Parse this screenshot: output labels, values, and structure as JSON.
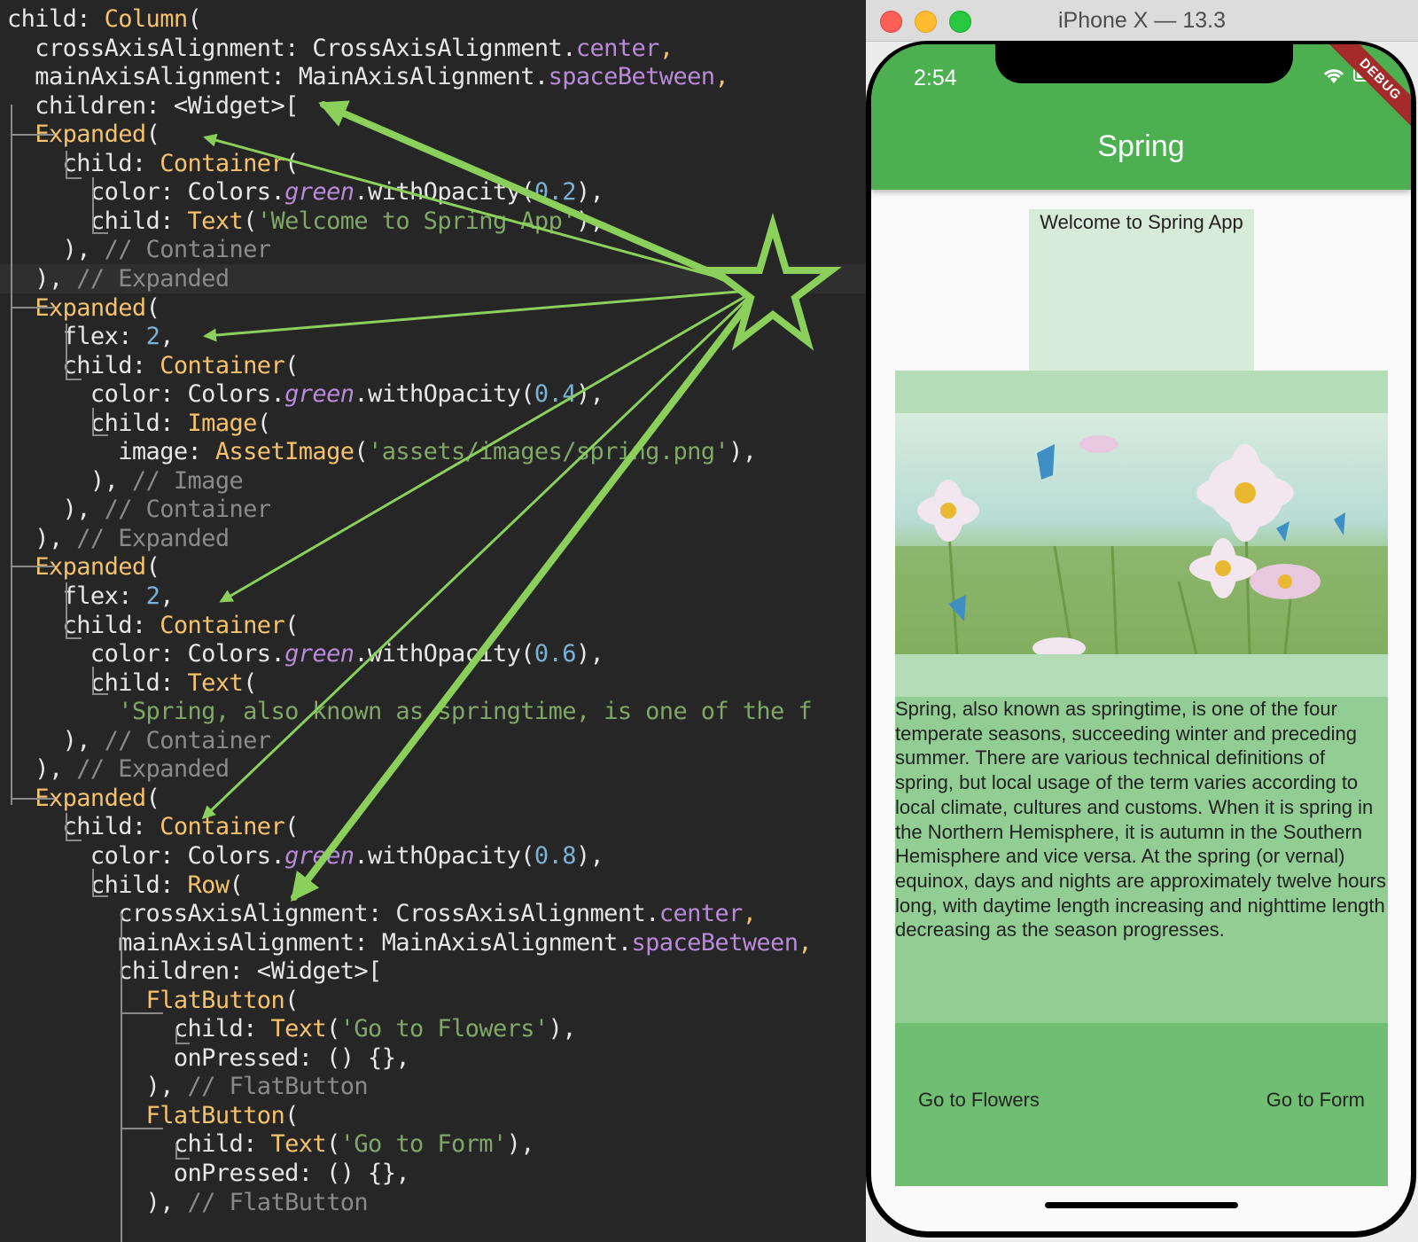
{
  "editor": {
    "lines": [
      [
        [
          "kw",
          "child: "
        ],
        [
          "cls",
          "Column"
        ],
        [
          "kw",
          "("
        ]
      ],
      [
        [
          "kw",
          "  crossAxisAlignment: CrossAxisAlignment."
        ],
        [
          "prop",
          "center"
        ],
        [
          "cls",
          ","
        ]
      ],
      [
        [
          "kw",
          "  mainAxisAlignment: MainAxisAlignment."
        ],
        [
          "prop",
          "spaceBetween"
        ],
        [
          "cls",
          ","
        ]
      ],
      [
        [
          "kw",
          "  children: <Widget>["
        ]
      ],
      [
        [
          "kw",
          "  "
        ],
        [
          "cls",
          "Expanded"
        ],
        [
          "kw",
          "("
        ]
      ],
      [
        [
          "kw",
          "    child: "
        ],
        [
          "cls",
          "Container"
        ],
        [
          "kw",
          "("
        ]
      ],
      [
        [
          "kw",
          "      color: Colors."
        ],
        [
          "it",
          "green"
        ],
        [
          "kw",
          ".withOpacity("
        ],
        [
          "num",
          "0.2"
        ],
        [
          "kw",
          "),"
        ]
      ],
      [
        [
          "kw",
          "      child: "
        ],
        [
          "cls",
          "Text"
        ],
        [
          "kw",
          "("
        ],
        [
          "str",
          "'Welcome to Spring App'"
        ],
        [
          "kw",
          "),"
        ]
      ],
      [
        [
          "kw",
          "    ), "
        ],
        [
          "cm",
          "// Container"
        ]
      ],
      [
        [
          "kw",
          "  ), "
        ],
        [
          "cm",
          "// Expanded"
        ]
      ],
      [
        [
          "kw",
          "  "
        ],
        [
          "cls",
          "Expanded"
        ],
        [
          "kw",
          "("
        ]
      ],
      [
        [
          "kw",
          "    flex: "
        ],
        [
          "num",
          "2"
        ],
        [
          "kw",
          ","
        ]
      ],
      [
        [
          "kw",
          "    child: "
        ],
        [
          "cls",
          "Container"
        ],
        [
          "kw",
          "("
        ]
      ],
      [
        [
          "kw",
          "      color: Colors."
        ],
        [
          "it",
          "green"
        ],
        [
          "kw",
          ".withOpacity("
        ],
        [
          "num",
          "0.4"
        ],
        [
          "kw",
          "),"
        ]
      ],
      [
        [
          "kw",
          "      child: "
        ],
        [
          "cls",
          "Image"
        ],
        [
          "kw",
          "("
        ]
      ],
      [
        [
          "kw",
          "        image: "
        ],
        [
          "cls",
          "AssetImage"
        ],
        [
          "kw",
          "("
        ],
        [
          "str",
          "'assets/images/spring.png'"
        ],
        [
          "kw",
          "),"
        ]
      ],
      [
        [
          "kw",
          "      ), "
        ],
        [
          "cm",
          "// Image"
        ]
      ],
      [
        [
          "kw",
          "    ), "
        ],
        [
          "cm",
          "// Container"
        ]
      ],
      [
        [
          "kw",
          "  ), "
        ],
        [
          "cm",
          "// Expanded"
        ]
      ],
      [
        [
          "kw",
          "  "
        ],
        [
          "cls",
          "Expanded"
        ],
        [
          "kw",
          "("
        ]
      ],
      [
        [
          "kw",
          "    flex: "
        ],
        [
          "num",
          "2"
        ],
        [
          "kw",
          ","
        ]
      ],
      [
        [
          "kw",
          "    child: "
        ],
        [
          "cls",
          "Container"
        ],
        [
          "kw",
          "("
        ]
      ],
      [
        [
          "kw",
          "      color: Colors."
        ],
        [
          "it",
          "green"
        ],
        [
          "kw",
          ".withOpacity("
        ],
        [
          "num",
          "0.6"
        ],
        [
          "kw",
          "),"
        ]
      ],
      [
        [
          "kw",
          "      child: "
        ],
        [
          "cls",
          "Text"
        ],
        [
          "kw",
          "("
        ]
      ],
      [
        [
          "kw",
          "        "
        ],
        [
          "str",
          "'Spring, also known as springtime, is one of the f"
        ]
      ],
      [
        [
          "kw",
          "    ), "
        ],
        [
          "cm",
          "// Container"
        ]
      ],
      [
        [
          "kw",
          "  ), "
        ],
        [
          "cm",
          "// Expanded"
        ]
      ],
      [
        [
          "kw",
          "  "
        ],
        [
          "cls",
          "Expanded"
        ],
        [
          "kw",
          "("
        ]
      ],
      [
        [
          "kw",
          "    child: "
        ],
        [
          "cls",
          "Container"
        ],
        [
          "kw",
          "("
        ]
      ],
      [
        [
          "kw",
          "      color: Colors."
        ],
        [
          "it",
          "green"
        ],
        [
          "kw",
          ".withOpacity("
        ],
        [
          "num",
          "0.8"
        ],
        [
          "kw",
          "),"
        ]
      ],
      [
        [
          "kw",
          "      child: "
        ],
        [
          "cls",
          "Row"
        ],
        [
          "kw",
          "("
        ]
      ],
      [
        [
          "kw",
          "        crossAxisAlignment: CrossAxisAlignment."
        ],
        [
          "prop",
          "center"
        ],
        [
          "cls",
          ","
        ]
      ],
      [
        [
          "kw",
          "        mainAxisAlignment: MainAxisAlignment."
        ],
        [
          "prop",
          "spaceBetween"
        ],
        [
          "cls",
          ","
        ]
      ],
      [
        [
          "kw",
          "        children: <Widget>["
        ]
      ],
      [
        [
          "kw",
          "          "
        ],
        [
          "cls",
          "FlatButton"
        ],
        [
          "kw",
          "("
        ]
      ],
      [
        [
          "kw",
          "            child: "
        ],
        [
          "cls",
          "Text"
        ],
        [
          "kw",
          "("
        ],
        [
          "str",
          "'Go to Flowers'"
        ],
        [
          "kw",
          "),"
        ]
      ],
      [
        [
          "kw",
          "            onPressed: () {},"
        ]
      ],
      [
        [
          "kw",
          "          ), "
        ],
        [
          "cm",
          "// FlatButton"
        ]
      ],
      [
        [
          "kw",
          "          "
        ],
        [
          "cls",
          "FlatButton"
        ],
        [
          "kw",
          "("
        ]
      ],
      [
        [
          "kw",
          "            child: "
        ],
        [
          "cls",
          "Text"
        ],
        [
          "kw",
          "("
        ],
        [
          "str",
          "'Go to Form'"
        ],
        [
          "kw",
          "),"
        ]
      ],
      [
        [
          "kw",
          "            onPressed: () {},"
        ]
      ],
      [
        [
          "kw",
          "          ), "
        ],
        [
          "cm",
          "// FlatButton"
        ]
      ]
    ]
  },
  "simulator": {
    "window_title": "iPhone X — 13.3",
    "status_time": "2:54",
    "debug_banner": "DEBUG",
    "app_title": "Spring",
    "welcome_text": "Welcome to Spring App",
    "image_description": "spring flowers with butterflies",
    "paragraph": "Spring, also known as springtime, is one of the four temperate seasons, succeeding winter and preceding summer. There are various technical definitions of spring, but local usage of the term varies according to local climate, cultures and customs. When it is spring in the Northern Hemisphere, it is autumn in the Southern Hemisphere and vice versa. At the spring (or vernal) equinox, days and nights are approximately twelve hours long, with daytime length increasing and nighttime length decreasing as the season progresses.",
    "button_flowers": "Go to Flowers",
    "button_form": "Go to Form"
  },
  "colors": {
    "accent_green": "#4caf50",
    "annotation_green": "#8bd05b",
    "editor_bg": "#262626"
  },
  "icons": [
    "star-annotation-icon",
    "wifi-icon",
    "battery-icon",
    "close-traffic-icon",
    "minimize-traffic-icon",
    "zoom-traffic-icon"
  ]
}
